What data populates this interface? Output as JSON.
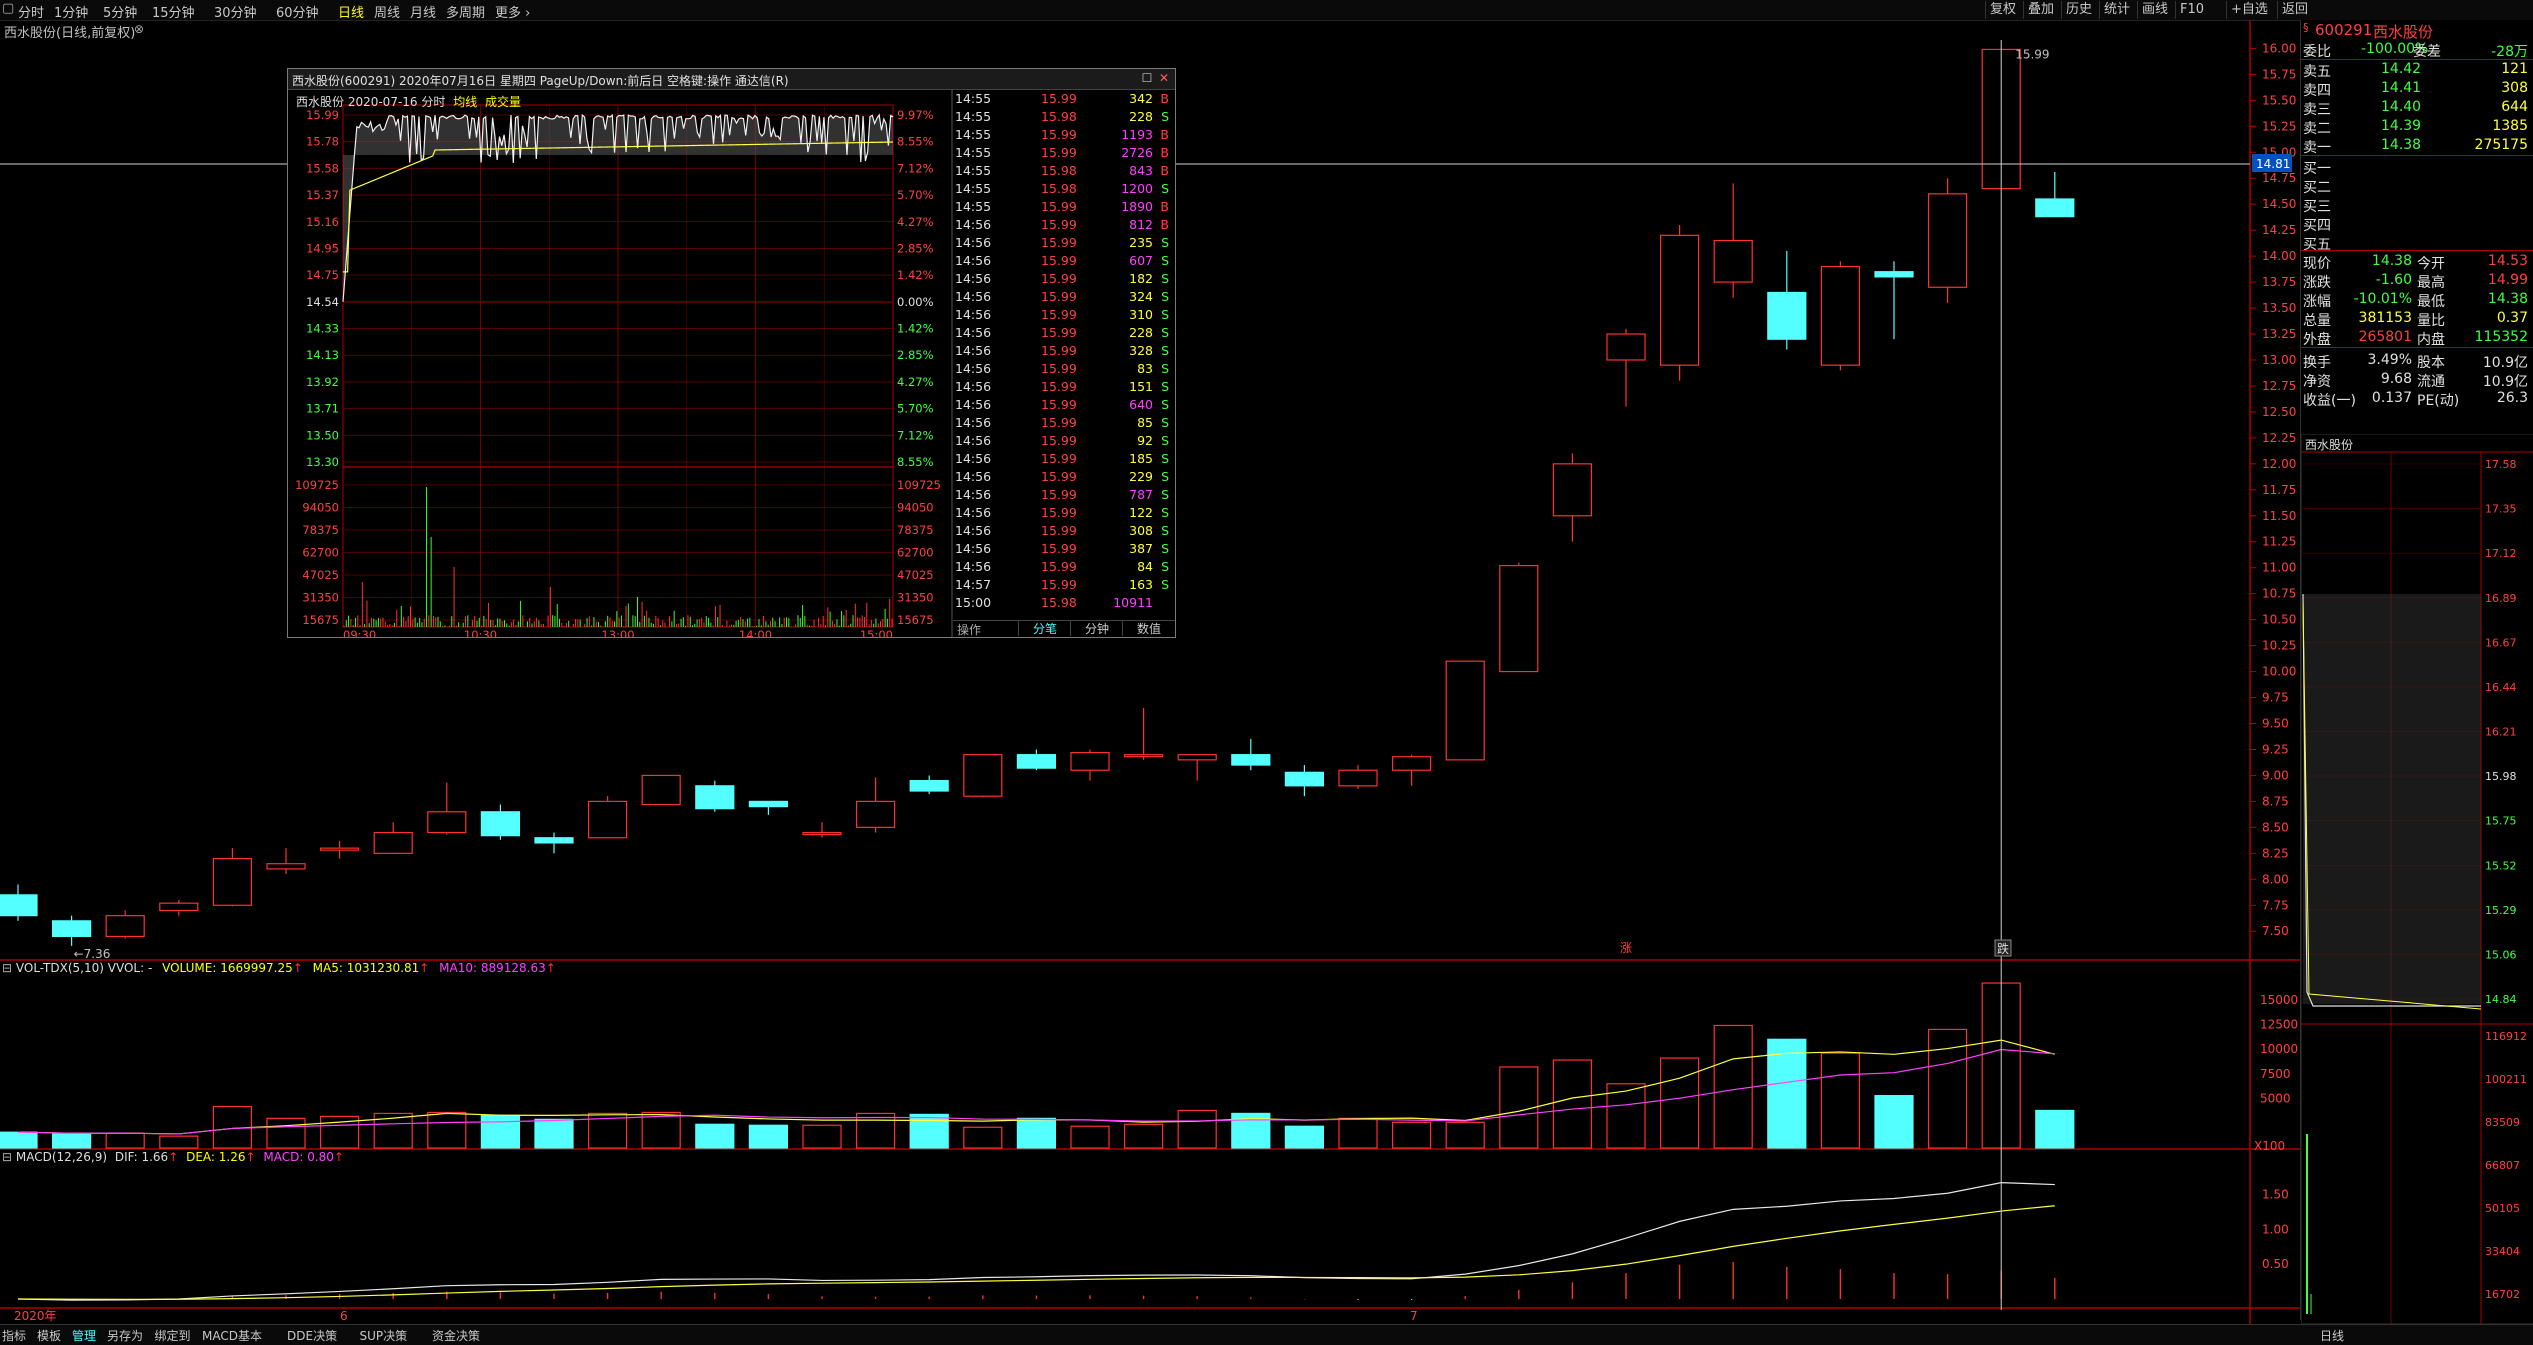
{
  "toolbar": {
    "periods": [
      "分时",
      "1分钟",
      "5分钟",
      "15分钟",
      "30分钟",
      "60分钟",
      "日线",
      "周线",
      "月线",
      "多周期",
      "更多"
    ],
    "active_period": "日线",
    "right_buttons": [
      "复权",
      "叠加",
      "历史",
      "统计",
      "画线",
      "F10",
      "+自选",
      "返回"
    ]
  },
  "chart": {
    "subtitle": "西水股份(日线,前复权)",
    "high_label": "15.99",
    "low_label": "7.36",
    "crosshair_price": "14.81",
    "price_axis": [
      "16.00",
      "15.75",
      "15.50",
      "15.25",
      "15.00",
      "14.75",
      "14.50",
      "14.25",
      "14.00",
      "13.75",
      "13.50",
      "13.25",
      "13.00",
      "12.75",
      "12.50",
      "12.25",
      "12.00",
      "11.75",
      "11.50",
      "11.25",
      "11.00",
      "10.75",
      "10.50",
      "10.25",
      "10.00",
      "9.75",
      "9.50",
      "9.25",
      "9.00",
      "8.75",
      "8.50",
      "8.25",
      "8.00",
      "7.75",
      "7.50"
    ],
    "markers": [
      "涨",
      "跌"
    ],
    "x_labels": [
      "2020年",
      "6",
      "7"
    ]
  },
  "chart_data": {
    "type": "candlestick",
    "ylim": [
      7.3,
      16.1
    ],
    "candles": [
      {
        "o": 7.85,
        "h": 7.95,
        "l": 7.6,
        "c": 7.65
      },
      {
        "o": 7.6,
        "h": 7.65,
        "l": 7.36,
        "c": 7.45
      },
      {
        "o": 7.45,
        "h": 7.7,
        "l": 7.43,
        "c": 7.65
      },
      {
        "o": 7.7,
        "h": 7.8,
        "l": 7.65,
        "c": 7.77
      },
      {
        "o": 7.75,
        "h": 8.3,
        "l": 7.74,
        "c": 8.2
      },
      {
        "o": 8.1,
        "h": 8.3,
        "l": 8.05,
        "c": 8.15
      },
      {
        "o": 8.3,
        "h": 8.37,
        "l": 8.2,
        "c": 8.3
      },
      {
        "o": 8.25,
        "h": 8.55,
        "l": 8.25,
        "c": 8.45
      },
      {
        "o": 8.45,
        "h": 8.93,
        "l": 8.43,
        "c": 8.65
      },
      {
        "o": 8.65,
        "h": 8.72,
        "l": 8.38,
        "c": 8.42
      },
      {
        "o": 8.4,
        "h": 8.45,
        "l": 8.25,
        "c": 8.35
      },
      {
        "o": 8.4,
        "h": 8.8,
        "l": 8.4,
        "c": 8.75
      },
      {
        "o": 8.72,
        "h": 9.0,
        "l": 8.72,
        "c": 9.0
      },
      {
        "o": 8.9,
        "h": 8.95,
        "l": 8.65,
        "c": 8.68
      },
      {
        "o": 8.75,
        "h": 8.75,
        "l": 8.62,
        "c": 8.7
      },
      {
        "o": 8.45,
        "h": 8.55,
        "l": 8.4,
        "c": 8.45
      },
      {
        "o": 8.5,
        "h": 8.98,
        "l": 8.45,
        "c": 8.75
      },
      {
        "o": 8.95,
        "h": 9.0,
        "l": 8.82,
        "c": 8.85
      },
      {
        "o": 8.8,
        "h": 9.2,
        "l": 8.79,
        "c": 9.2
      },
      {
        "o": 9.2,
        "h": 9.25,
        "l": 9.05,
        "c": 9.07
      },
      {
        "o": 9.05,
        "h": 9.25,
        "l": 8.95,
        "c": 9.22
      },
      {
        "o": 9.2,
        "h": 9.65,
        "l": 9.15,
        "c": 9.2
      },
      {
        "o": 9.15,
        "h": 9.2,
        "l": 8.95,
        "c": 9.2
      },
      {
        "o": 9.2,
        "h": 9.35,
        "l": 9.05,
        "c": 9.1
      },
      {
        "o": 9.03,
        "h": 9.1,
        "l": 8.8,
        "c": 8.9
      },
      {
        "o": 8.9,
        "h": 9.1,
        "l": 8.87,
        "c": 9.05
      },
      {
        "o": 9.05,
        "h": 9.2,
        "l": 8.9,
        "c": 9.18
      },
      {
        "o": 9.15,
        "h": 10.1,
        "l": 9.15,
        "c": 10.1
      },
      {
        "o": 10.0,
        "h": 11.05,
        "l": 10.0,
        "c": 11.02
      },
      {
        "o": 11.5,
        "h": 12.1,
        "l": 11.25,
        "c": 12.0
      },
      {
        "o": 13.0,
        "h": 13.3,
        "l": 12.55,
        "c": 13.25
      },
      {
        "o": 12.95,
        "h": 14.3,
        "l": 12.8,
        "c": 14.2
      },
      {
        "o": 13.75,
        "h": 14.7,
        "l": 13.6,
        "c": 14.15
      },
      {
        "o": 13.65,
        "h": 14.05,
        "l": 13.1,
        "c": 13.2
      },
      {
        "o": 12.95,
        "h": 13.95,
        "l": 12.9,
        "c": 13.9
      },
      {
        "o": 13.85,
        "h": 13.95,
        "l": 13.2,
        "c": 13.8
      },
      {
        "o": 13.7,
        "h": 14.75,
        "l": 13.55,
        "c": 14.6
      },
      {
        "o": 14.65,
        "h": 16.0,
        "l": 14.65,
        "c": 15.99
      },
      {
        "o": 14.55,
        "h": 14.81,
        "l": 14.38,
        "c": 14.38
      }
    ],
    "volume_ma_labels": {
      "name": "VOL-TDX(5,10)",
      "vvol": "VVOL: -",
      "volume": "VOLUME: 1669997.25",
      "ma5": "MA5: 1031230.81",
      "ma10": "MA10: 889128.63"
    },
    "volume_axis": [
      "15000",
      "12500",
      "10000",
      "7500",
      "5000",
      "X100"
    ],
    "volumes": [
      1.6,
      1.4,
      1.5,
      1.2,
      4.2,
      3.0,
      3.2,
      3.5,
      3.6,
      3.3,
      2.9,
      3.5,
      3.6,
      2.4,
      2.3,
      2.3,
      3.5,
      3.4,
      2.1,
      3.0,
      2.2,
      2.4,
      3.8,
      3.5,
      2.2,
      3.0,
      2.6,
      2.6,
      8.2,
      8.9,
      6.5,
      9.1,
      12.4,
      11.0,
      9.6,
      5.3,
      12.0,
      16.69,
      3.8
    ],
    "macd_labels": {
      "name": "MACD(12,26,9)",
      "dif": "DIF: 1.66",
      "dea": "DEA: 1.26",
      "macd": "MACD: 0.80"
    },
    "macd_axis": [
      "1.50",
      "1.00",
      "0.50"
    ]
  },
  "popup": {
    "title": "西水股份(600291) 2020年07月16日 星期四 PageUp/Down:前后日 空格键:操作 通达信(R)",
    "header": "西水股份    2020-07-16 分时",
    "legend_avg": "均线",
    "legend_vol": "成交量",
    "price_labels": [
      "15.99",
      "15.78",
      "15.58",
      "15.37",
      "15.16",
      "14.95",
      "14.75",
      "14.54",
      "14.33",
      "14.13",
      "13.92",
      "13.71",
      "13.50",
      "13.30"
    ],
    "pct_labels": [
      "9.97%",
      "8.55%",
      "7.12%",
      "5.70%",
      "4.27%",
      "2.85%",
      "1.42%",
      "0.00%",
      "1.42%",
      "2.85%",
      "4.27%",
      "5.70%",
      "7.12%",
      "8.55%"
    ],
    "vol_labels": [
      "109725",
      "94050",
      "78375",
      "62700",
      "47025",
      "31350",
      "15675"
    ],
    "time_labels": [
      "09:30",
      "10:30",
      "13:00",
      "14:00",
      "15:00"
    ],
    "ticks": [
      {
        "t": "14:55",
        "p": "15.99",
        "v": "342",
        "d": "B"
      },
      {
        "t": "14:55",
        "p": "15.98",
        "v": "228",
        "d": "S"
      },
      {
        "t": "14:55",
        "p": "15.99",
        "v": "1193",
        "d": "B"
      },
      {
        "t": "14:55",
        "p": "15.99",
        "v": "2726",
        "d": "B"
      },
      {
        "t": "14:55",
        "p": "15.98",
        "v": "843",
        "d": "B"
      },
      {
        "t": "14:55",
        "p": "15.98",
        "v": "1200",
        "d": "S"
      },
      {
        "t": "14:55",
        "p": "15.99",
        "v": "1890",
        "d": "B"
      },
      {
        "t": "14:56",
        "p": "15.99",
        "v": "812",
        "d": "B"
      },
      {
        "t": "14:56",
        "p": "15.99",
        "v": "235",
        "d": "S"
      },
      {
        "t": "14:56",
        "p": "15.99",
        "v": "607",
        "d": "S"
      },
      {
        "t": "14:56",
        "p": "15.99",
        "v": "182",
        "d": "S"
      },
      {
        "t": "14:56",
        "p": "15.99",
        "v": "324",
        "d": "S"
      },
      {
        "t": "14:56",
        "p": "15.99",
        "v": "310",
        "d": "S"
      },
      {
        "t": "14:56",
        "p": "15.99",
        "v": "228",
        "d": "S"
      },
      {
        "t": "14:56",
        "p": "15.99",
        "v": "328",
        "d": "S"
      },
      {
        "t": "14:56",
        "p": "15.99",
        "v": "83",
        "d": "S"
      },
      {
        "t": "14:56",
        "p": "15.99",
        "v": "151",
        "d": "S"
      },
      {
        "t": "14:56",
        "p": "15.99",
        "v": "640",
        "d": "S"
      },
      {
        "t": "14:56",
        "p": "15.99",
        "v": "85",
        "d": "S"
      },
      {
        "t": "14:56",
        "p": "15.99",
        "v": "92",
        "d": "S"
      },
      {
        "t": "14:56",
        "p": "15.99",
        "v": "185",
        "d": "S"
      },
      {
        "t": "14:56",
        "p": "15.99",
        "v": "229",
        "d": "S"
      },
      {
        "t": "14:56",
        "p": "15.99",
        "v": "787",
        "d": "S"
      },
      {
        "t": "14:56",
        "p": "15.99",
        "v": "122",
        "d": "S"
      },
      {
        "t": "14:56",
        "p": "15.99",
        "v": "308",
        "d": "S"
      },
      {
        "t": "14:56",
        "p": "15.99",
        "v": "387",
        "d": "S"
      },
      {
        "t": "14:56",
        "p": "15.99",
        "v": "84",
        "d": "S"
      },
      {
        "t": "14:57",
        "p": "15.99",
        "v": "163",
        "d": "S"
      },
      {
        "t": "15:00",
        "p": "15.98",
        "v": "10911",
        "d": ""
      }
    ],
    "footer_left": "操作",
    "footer_tabs": [
      "分笔",
      "分钟",
      "数值"
    ]
  },
  "quote": {
    "code": "600291",
    "name": "西水股份",
    "weibi_label": "委比",
    "weibi_value": "-100.00%",
    "weicha_label": "委差",
    "weicha_value": "-28万",
    "sell": [
      {
        "label": "卖五",
        "price": "14.42",
        "vol": "121"
      },
      {
        "label": "卖四",
        "price": "14.41",
        "vol": "308"
      },
      {
        "label": "卖三",
        "price": "14.40",
        "vol": "644"
      },
      {
        "label": "卖二",
        "price": "14.39",
        "vol": "1385"
      },
      {
        "label": "卖一",
        "price": "14.38",
        "vol": "275175"
      }
    ],
    "buy": [
      "买一",
      "买二",
      "买三",
      "买四",
      "买五"
    ],
    "stats": [
      {
        "l1": "现价",
        "v1": "14.38",
        "l2": "今开",
        "v2": "14.53"
      },
      {
        "l1": "涨跌",
        "v1": "-1.60",
        "l2": "最高",
        "v2": "14.99"
      },
      {
        "l1": "涨幅",
        "v1": "-10.01%",
        "l2": "最低",
        "v2": "14.38"
      },
      {
        "l1": "总量",
        "v1": "381153",
        "l2": "量比",
        "v2": "0.37"
      },
      {
        "l1": "外盘",
        "v1": "265801",
        "l2": "内盘",
        "v2": "115352"
      },
      {
        "l1": "换手",
        "v1": "3.49%",
        "l2": "股本",
        "v2": "10.9亿"
      },
      {
        "l1": "净资",
        "v1": "9.68",
        "l2": "流通",
        "v2": "10.9亿"
      },
      {
        "l1": "收益(一)",
        "v1": "0.137",
        "l2": "PE(动)",
        "v2": "26.3"
      }
    ],
    "mini_title": "西水股份",
    "mini_price_axis": [
      "17.58",
      "17.35",
      "17.12",
      "16.89",
      "16.67",
      "16.44",
      "16.21",
      "15.98",
      "15.75",
      "15.52",
      "15.29",
      "15.06",
      "14.84"
    ],
    "mini_vol_axis": [
      "116912",
      "100211",
      "83509",
      "66807",
      "50105",
      "33404",
      "16702"
    ],
    "mini_tab": "日线"
  },
  "bottom": {
    "items": [
      "指标",
      "模板",
      "管理",
      "另存为",
      "绑定到",
      "MACD基本",
      "DDE决策",
      "SUP决策",
      "资金决策"
    ],
    "active": "管理"
  }
}
